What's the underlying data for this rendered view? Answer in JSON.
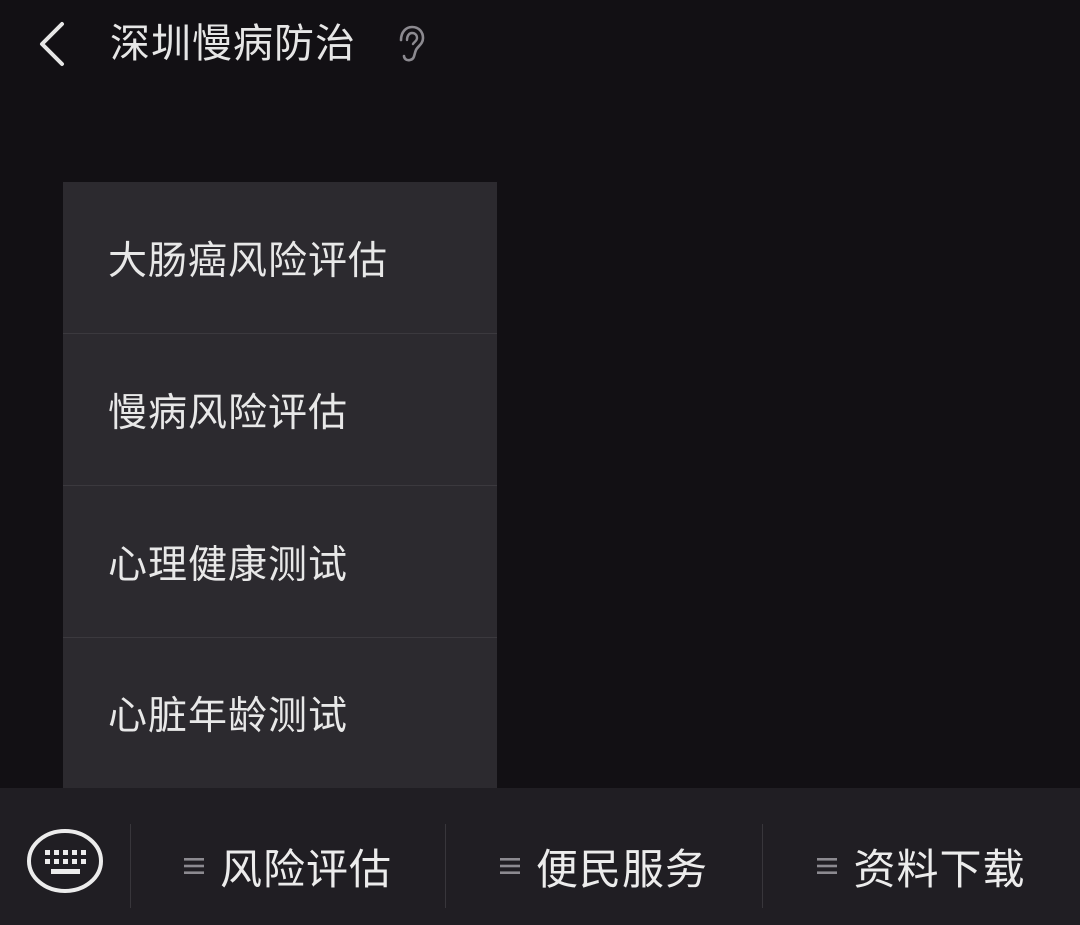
{
  "header": {
    "title": "深圳慢病防治",
    "back_icon": "chevron-left-icon",
    "ear_icon": "ear-icon"
  },
  "popup_menu": {
    "items": [
      {
        "label": "大肠癌风险评估"
      },
      {
        "label": "慢病风险评估"
      },
      {
        "label": "心理健康测试"
      },
      {
        "label": "心脏年龄测试"
      }
    ]
  },
  "bottom_bar": {
    "keyboard_icon": "keyboard-icon",
    "menu_icon": "list-icon",
    "menus": [
      {
        "label": "风险评估"
      },
      {
        "label": "便民服务"
      },
      {
        "label": "资料下载"
      }
    ]
  },
  "colors": {
    "background": "#121014",
    "popup_background": "#2c2a2f",
    "bottom_bar_background": "#201e23",
    "text": "#ececec",
    "icon_gray": "#8c8a90"
  }
}
